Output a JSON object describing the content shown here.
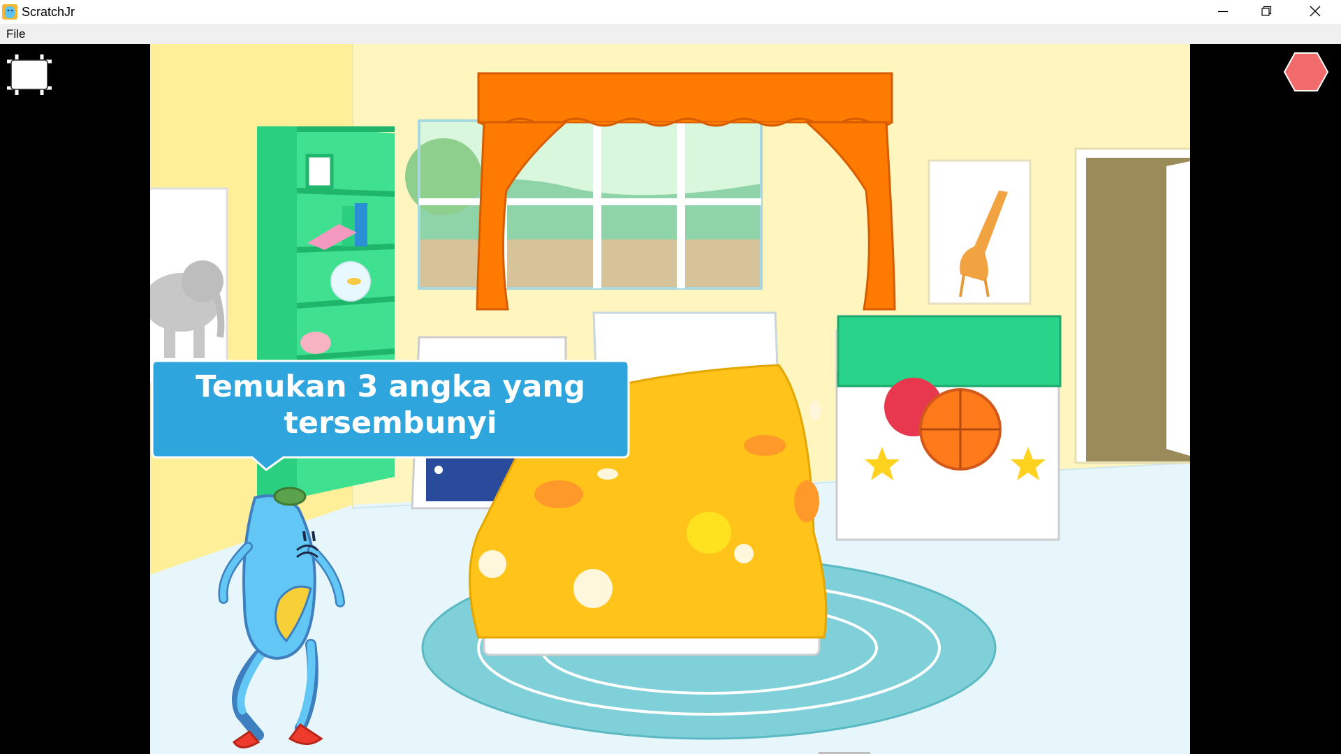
{
  "window": {
    "title": "ScratchJr",
    "minimize_icon": "minimize-icon",
    "maximize_icon": "restore-icon",
    "close_icon": "close-icon"
  },
  "menu": {
    "items": [
      {
        "label": "File"
      }
    ]
  },
  "controls": {
    "fullscreen_icon": "fullscreen-exit-icon",
    "stop_icon": "stop-hexagon-icon",
    "stop_color": "#f26b6b"
  },
  "stage": {
    "background": "bedroom",
    "speech_bubble": {
      "text": "Temukan 3 angka yang tersembunyi",
      "color": "#2ea6dd"
    },
    "characters": [
      "blue-character"
    ]
  }
}
